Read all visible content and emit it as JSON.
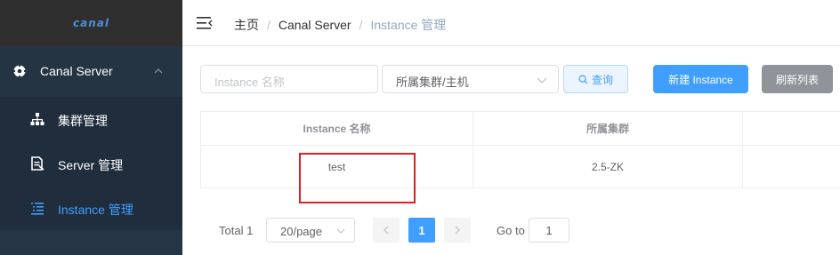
{
  "sidebar": {
    "logo": "canal",
    "group": {
      "label": "Canal Server",
      "icon": "gear-icon",
      "expanded": true
    },
    "items": [
      {
        "label": "集群管理",
        "icon": "cluster-icon",
        "active": false
      },
      {
        "label": "Server 管理",
        "icon": "server-doc-icon",
        "active": false
      },
      {
        "label": "Instance 管理",
        "icon": "list-icon",
        "active": true
      }
    ]
  },
  "header": {
    "breadcrumb": [
      "主页",
      "Canal Server",
      "Instance 管理"
    ],
    "separator": "/"
  },
  "filters": {
    "name_placeholder": "Instance 名称",
    "cluster_value": "所属集群/主机",
    "search_label": "查询",
    "new_label": "新建 Instance",
    "refresh_label": "刷新列表"
  },
  "table": {
    "columns": [
      "Instance 名称",
      "所属集群",
      ""
    ],
    "rows": [
      {
        "name": "test",
        "cluster": "2.5-ZK",
        "extra": ""
      }
    ]
  },
  "pagination": {
    "total": "Total 1",
    "page_size": "20/page",
    "current_page": "1",
    "goto_label": "Go to",
    "goto_value": "1"
  },
  "colors": {
    "sidebar_bg": "#2c3e50",
    "active_text": "#409eff",
    "primary": "#409eff",
    "highlight": "#e02020"
  }
}
